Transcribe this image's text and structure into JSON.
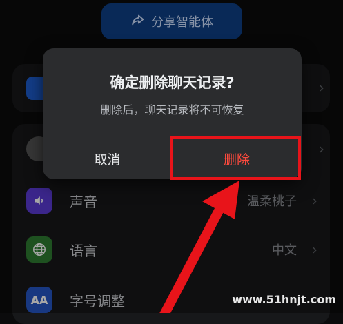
{
  "share": {
    "label": "分享智能体",
    "icon": "share-arrow-icon"
  },
  "settings": {
    "rows": [
      {
        "label": "声音",
        "value": "温柔桃子",
        "icon": "speaker-icon",
        "color": "#5b3bd6"
      },
      {
        "label": "语言",
        "value": "中文",
        "icon": "globe-icon",
        "color": "#2e7d32"
      },
      {
        "label": "字号调整",
        "value": "",
        "icon": "font-size-icon",
        "color": "#2557c7"
      }
    ]
  },
  "dialog": {
    "title": "确定删除聊天记录?",
    "message": "删除后，聊天记录将不可恢复",
    "cancel_label": "取消",
    "delete_label": "删除",
    "delete_color": "#ff4a3d"
  },
  "annotation": {
    "highlight_color": "#e8141a"
  },
  "watermark": {
    "text": "www.51hnjt.com"
  }
}
